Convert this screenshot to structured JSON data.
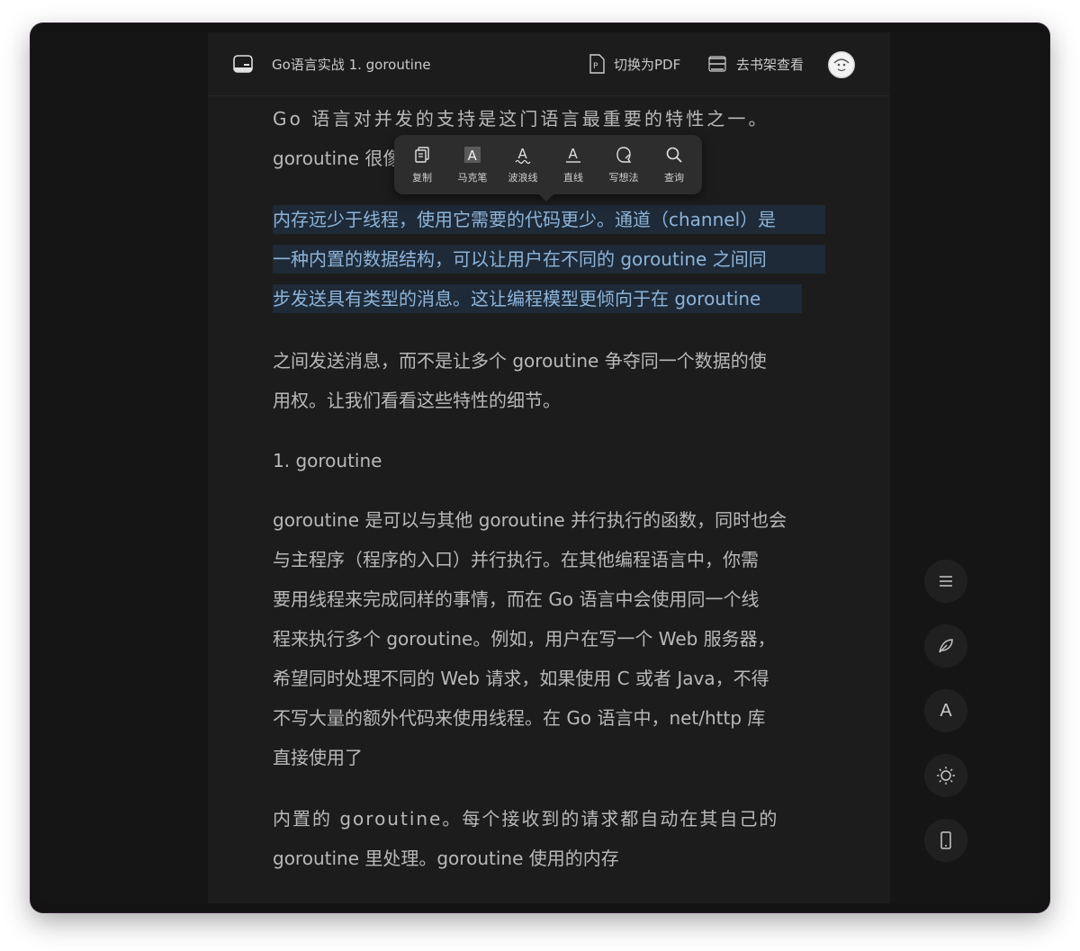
{
  "header": {
    "title": "Go语言实战 1.  goroutine",
    "switch_pdf_label": "切换为PDF",
    "bookshelf_label": "去书架查看"
  },
  "toolbar": {
    "items": [
      {
        "label": "复制",
        "icon": "copy-icon"
      },
      {
        "label": "马克笔",
        "icon": "marker-icon"
      },
      {
        "label": "波浪线",
        "icon": "wavy-underline-icon"
      },
      {
        "label": "直线",
        "icon": "straight-underline-icon"
      },
      {
        "label": "写想法",
        "icon": "write-thought-icon"
      },
      {
        "label": "查询",
        "icon": "search-icon"
      }
    ]
  },
  "content": {
    "p1": [
      "Go 语言对并发的支持是这门语言最重要的特性之一。",
      "goroutine 很像"
    ],
    "p2_highlighted": [
      "内存远少于线程，使用它需要的代码更少。通道（channel）是",
      "一种内置的数据结构，可以让用户在不同的 goroutine 之间同",
      "步发送具有类型的消息。这让编程模型更倾向于在 goroutine"
    ],
    "p3": [
      "之间发送消息，而不是让多个 goroutine 争夺同一个数据的使",
      "用权。让我们看看这些特性的细节。"
    ],
    "heading": "1.  goroutine",
    "p4": [
      "goroutine 是可以与其他 goroutine 并行执行的函数，同时也会",
      "与主程序（程序的入口）并行执行。在其他编程语言中，你需",
      "要用线程来完成同样的事情，而在 Go 语言中会使用同一个线",
      "程来执行多个 goroutine。例如，用户在写一个 Web 服务器，",
      "希望同时处理不同的 Web 请求，如果使用 C 或者 Java，不得",
      "不写大量的额外代码来使用线程。在 Go 语言中，net/http 库",
      "直接使用了"
    ],
    "p5": [
      "内置的 goroutine。每个接收到的请求都自动在其自己的",
      "goroutine 里处理。goroutine 使用的内存"
    ]
  },
  "side_buttons": [
    {
      "icon": "menu-icon"
    },
    {
      "icon": "notes-leaf-icon"
    },
    {
      "icon": "font-icon",
      "glyph": "A"
    },
    {
      "icon": "brightness-icon"
    },
    {
      "icon": "phone-icon"
    }
  ],
  "colors": {
    "background": "#1c1c1c",
    "text": "#b9b9b9",
    "highlight_bg": "#1e2a38",
    "highlight_text": "#8eb4d8"
  }
}
